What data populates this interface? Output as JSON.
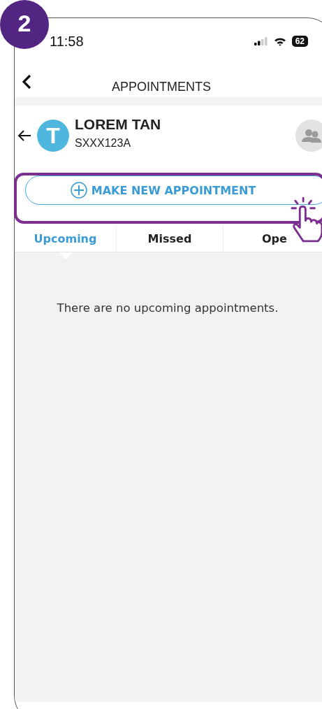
{
  "step_badge": "2",
  "status_bar": {
    "time": "11:58",
    "battery": "62"
  },
  "header": {
    "title": "APPOINTMENTS"
  },
  "patient": {
    "initial": "T",
    "name": "LOREM TAN",
    "id": "SXXX123A"
  },
  "new_appointment_button": {
    "label": "MAKE NEW APPOINTMENT",
    "highlighted": true
  },
  "tabs": [
    {
      "label": "Upcoming",
      "selected": true
    },
    {
      "label": "Missed",
      "selected": false
    },
    {
      "label": "Ope",
      "selected": false
    }
  ],
  "empty_message": "There are no upcoming appointments."
}
